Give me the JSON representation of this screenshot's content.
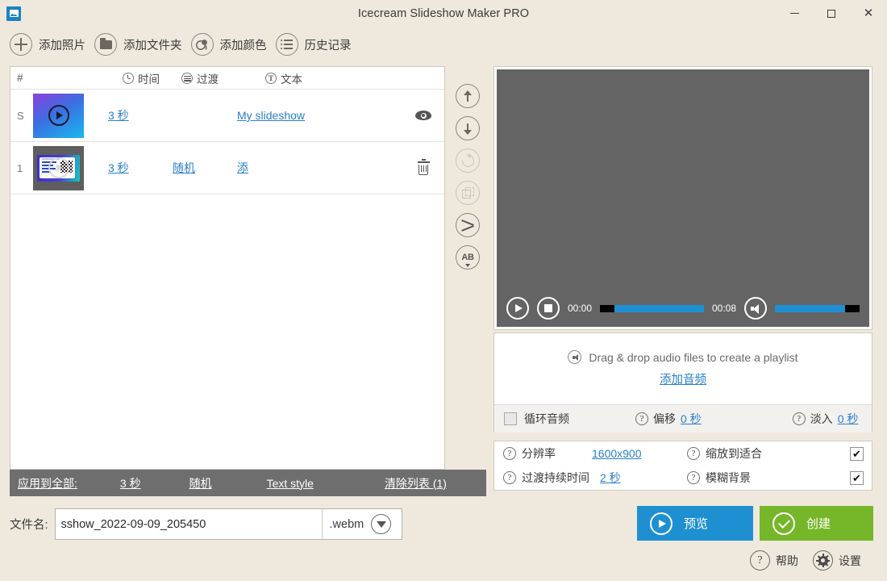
{
  "window": {
    "title": "Icecream Slideshow Maker PRO",
    "app_icon": "image-app-icon",
    "minimize": "minimize-icon",
    "maximize": "maximize-icon",
    "close": "close-icon"
  },
  "toolbar": {
    "items": [
      {
        "label": "添加照片",
        "icon": "plus-icon"
      },
      {
        "label": "添加文件夹",
        "icon": "folder-icon"
      },
      {
        "label": "添加颜色",
        "icon": "color-icon"
      },
      {
        "label": "历史记录",
        "icon": "list-icon"
      }
    ]
  },
  "list": {
    "headers": {
      "num": "#",
      "time": "时间",
      "transition": "过渡",
      "text": "文本"
    },
    "rows": [
      {
        "num": "S",
        "thumb": "slideshow-intro-thumbnail",
        "time": "3 秒",
        "transition": "",
        "text": "My slideshow",
        "action": "eye-icon"
      },
      {
        "num": "1",
        "thumb": "slide-1-thumbnail",
        "time": "3 秒",
        "transition": "随机",
        "text": "添",
        "action": "trash-icon"
      }
    ]
  },
  "rail": {
    "buttons": [
      {
        "name": "move-up-button",
        "icon": "arrow-up-icon",
        "enabled": true
      },
      {
        "name": "move-down-button",
        "icon": "arrow-down-icon",
        "enabled": true
      },
      {
        "name": "rotate-button",
        "icon": "refresh-icon",
        "enabled": false
      },
      {
        "name": "duplicate-button",
        "icon": "copy-icon",
        "enabled": false
      },
      {
        "name": "shuffle-button",
        "icon": "shuffle-icon",
        "enabled": true
      },
      {
        "name": "sort-ab-button",
        "icon": "ab-sort-icon",
        "label": "AB",
        "enabled": true
      }
    ]
  },
  "apply_bar": {
    "label": "应用到全部:",
    "duration": "3 秒",
    "transition": "随机",
    "text_style": "Text style",
    "clear_list": "清除列表 (1)"
  },
  "filename": {
    "label": "文件名:",
    "value": "sshow_2022-09-09_205450",
    "placeholder": "sshow_2022-09-09_205450",
    "extension": ".webm",
    "dropdown_icon": "chevron-down-icon"
  },
  "preview": {
    "play_icon": "play-icon",
    "stop_icon": "stop-icon",
    "current_time": "00:00",
    "total_time": "00:08",
    "volume_icon": "speaker-icon",
    "seek_percent": 0,
    "volume_percent": 85
  },
  "audio": {
    "drop_hint": "Drag & drop audio files to create a playlist",
    "drop_icon": "speaker-icon",
    "add_audio": "添加音频",
    "loop_label": "循环音频",
    "loop_checked": false,
    "offset_label": "偏移",
    "offset_value": "0 秒",
    "fade_label": "淡入",
    "fade_value": "0 秒",
    "help_icon": "question-icon"
  },
  "settings": {
    "resolution_label": "分辨率",
    "resolution_value": "1600x900",
    "transition_duration_label": "过渡持续时间",
    "transition_duration_value": "2 秒",
    "zoom_to_fit_label": "缩放到适合",
    "zoom_to_fit_checked": true,
    "blur_background_label": "模糊背景",
    "blur_background_checked": true,
    "checkmark": "✔",
    "help_icon": "question-icon"
  },
  "actions": {
    "preview_label": "预览",
    "preview_icon": "play-icon",
    "create_label": "创建",
    "create_icon": "check-icon",
    "help_label": "帮助",
    "help_icon": "question-icon",
    "settings_label": "设置",
    "settings_icon": "gear-icon"
  },
  "colors": {
    "background": "#efe9dd",
    "accent_blue": "#1e90d2",
    "link_blue": "#2a7fc9",
    "create_green": "#76b72a",
    "apply_bar_gray": "#6e6e6e",
    "stage_gray": "#646464"
  }
}
